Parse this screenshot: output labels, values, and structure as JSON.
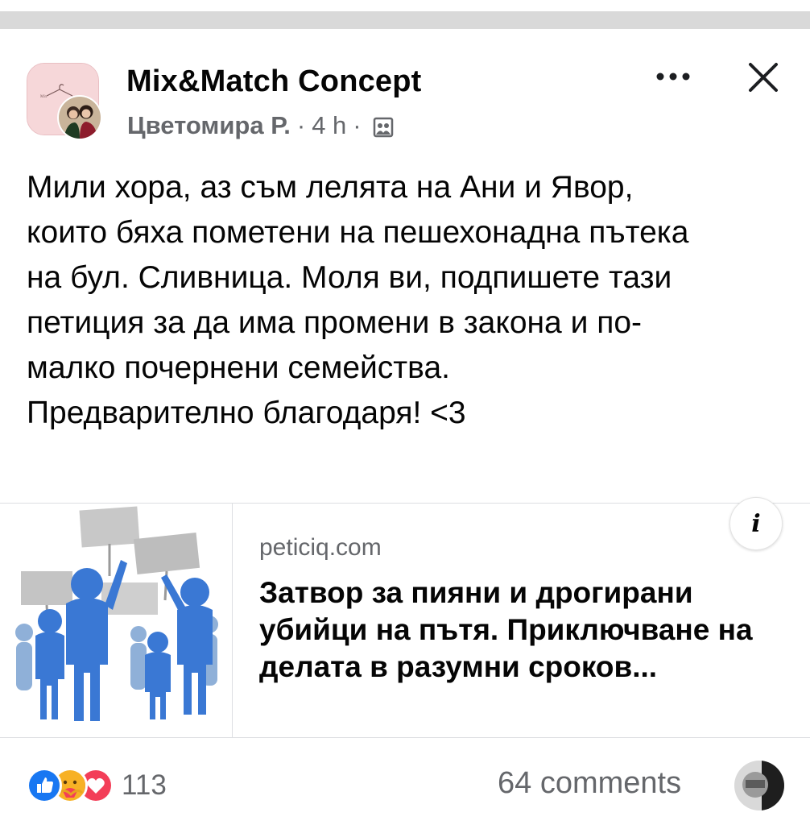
{
  "post": {
    "page_name": "Mix&Match Concept",
    "author": "Цветомира Р.",
    "separator": "·",
    "time": "4 h",
    "audience_icon": "group-audience-icon",
    "more_icon": "more-horizontal-icon",
    "close_icon": "close-icon",
    "text_lines": [
      "Мили хора, аз съм лелята на Ани и Явор,",
      "които бяха пометени на пешехонадна пътека",
      "на бул. Сливница. Моля ви, подпишете тази",
      "петиция за да има промени в закона и по-",
      "малко почернени семейства.",
      "Предварително благодаря! <3"
    ]
  },
  "link_card": {
    "domain": "peticiq.com",
    "title": "Затвор за пияни и дрогирани убийци на пътя. Приключване на делата в разумни сроков...",
    "info_label": "i",
    "thumbnail": "protest-crowd-illustration"
  },
  "footer": {
    "reactions": [
      "like",
      "care",
      "love"
    ],
    "reaction_count": "113",
    "comments_label": "64 comments"
  },
  "colors": {
    "secondary_text": "#65676b",
    "primary_text": "#050505",
    "like_blue": "#1877f2",
    "love_red": "#f33e58",
    "care_yellow": "#f7b125"
  }
}
